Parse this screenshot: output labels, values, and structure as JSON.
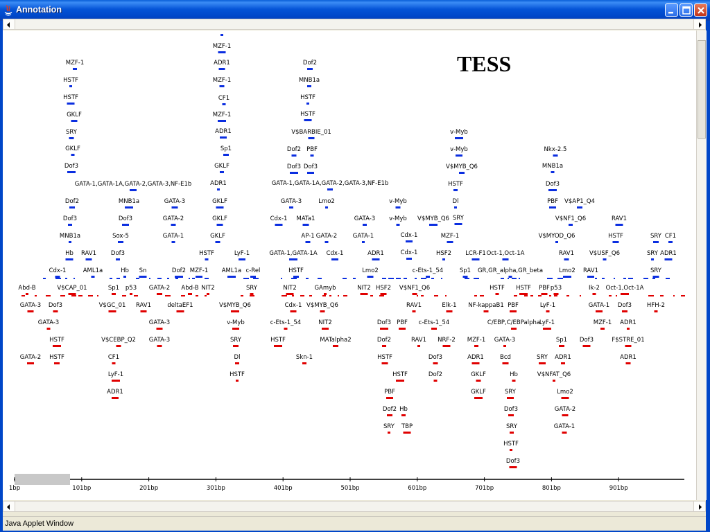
{
  "window": {
    "title": "Annotation",
    "status_text": "Java Applet Window",
    "heading": "TESS"
  },
  "colors": {
    "forward_strand": "#0b2ee0",
    "reverse_strand": "#e00000",
    "axis": "#000000"
  },
  "icons": [
    "java-icon",
    "minimize-icon",
    "maximize-icon",
    "close-icon",
    "scroll-left-icon",
    "scroll-right-icon"
  ],
  "axis": {
    "ticks": [
      "1bp",
      "101bp",
      "201bp",
      "301bp",
      "401bp",
      "501bp",
      "601bp",
      "701bp",
      "801bp",
      "901bp"
    ]
  },
  "annotations": {
    "forward": [
      "ADR1",
      "MZF-1",
      "ADR1",
      "MZF-1",
      "CF1",
      "MZF-1",
      "ADR1",
      "Sp1",
      "GKLF",
      "ADR1",
      "GKLF",
      "GKLF",
      "GKLF",
      "HSTF",
      "AML1a",
      "LyF-1",
      "c-Rel",
      "MZF-1",
      "HSTF",
      "HSTF",
      "GKLF",
      "SRY",
      "GKLF",
      "Dof3",
      "GATA-1,GATA-1A,GATA-2,GATA-3,NF-E1b",
      "Dof2",
      "Dof3",
      "MNB1a",
      "Hb",
      "RAV1",
      "Cdx-1",
      "AML1a",
      "MNB1a",
      "Dof3",
      "Sox-5",
      "Dof3",
      "Hb",
      "Sn",
      "GATA-3",
      "GATA-2",
      "GATA-1",
      "Dof2",
      "MZF-1",
      "Dof2",
      "MNB1a",
      "HSTF",
      "HSTF",
      "V$BARBIE_01",
      "Dof2",
      "PBF",
      "Dof3",
      "Dof3",
      "GATA-1,GATA-1A,GATA-2,GATA-3,NF-E1b",
      "GATA-3",
      "Lmo2",
      "Cdx-1",
      "MATa1",
      "AP-1",
      "GATA-2",
      "GATA-1,GATA-1A",
      "Cdx-1",
      "HSTF",
      "GATA-3",
      "GATA-1",
      "ADR1",
      "Lmo2",
      "v-Myb",
      "v-Myb",
      "V$MYB_Q6",
      "Cdx-1",
      "Cdx-1",
      "c-Ets-1_54",
      "HSF2",
      "LCR-F1",
      "Oct-1,Oct-1A",
      "Sp1",
      "GR,GR_alpha,GR_beta",
      "v-Myb",
      "v-Myb",
      "V$MYB_Q6",
      "HSTF",
      "Dl",
      "SRY",
      "MZF-1",
      "Nkx-2.5",
      "MNB1a",
      "Dof3",
      "PBF",
      "V$AP1_Q4",
      "V$NF1_Q6",
      "V$MYOD_Q6",
      "RAV1",
      "HSTF",
      "RAV1",
      "V$USF_Q6",
      "Lmo2",
      "RAV1",
      "SRY",
      "CF1",
      "SRY",
      "ADR1",
      "SRY"
    ],
    "reverse": [
      "Abd-B",
      "V$CAP_01",
      "GATA-3",
      "Dof3",
      "GATA-3",
      "HSTF",
      "GATA-2",
      "HSTF",
      "Sp1",
      "p53",
      "V$GC_01",
      "RAV1",
      "V$CEBP_Q2",
      "CF1",
      "LyF-1",
      "ADR1",
      "GATA-2",
      "Abd-B",
      "NIT2",
      "deltaEF1",
      "GATA-3",
      "GATA-3",
      "SRY",
      "V$MYB_Q6",
      "v-Myb",
      "SRY",
      "Dl",
      "HSTF",
      "NIT2",
      "Cdx-1",
      "V$MYB_Q6",
      "c-Ets-1_54",
      "HSTF",
      "NIT2",
      "MATalpha2",
      "Skn-1",
      "GAmyb",
      "NIT2",
      "HSF2",
      "V$NF1_Q6",
      "RAV1",
      "Dof3",
      "PBF",
      "c-Ets-1_54",
      "Dof2",
      "RAV1",
      "NRF-2",
      "HSTF",
      "Dof3",
      "Dof2",
      "HSTF",
      "PBF",
      "Dof2",
      "Hb",
      "SRY",
      "TBP",
      "Elk-1",
      "NF-kappaB1",
      "HSTF",
      "HSTF",
      "PBF",
      "C/EBP,C/EBPalpha",
      "MZF-1",
      "GATA-3",
      "ADR1",
      "Bcd",
      "GKLF",
      "Hb",
      "GKLF",
      "SRY",
      "Dof3",
      "SRY",
      "HSTF",
      "Dof3",
      "PBF",
      "p53",
      "LyF-1",
      "LyF-1",
      "SRY",
      "Sp1",
      "ADR1",
      "V$NFAT_Q6",
      "Lmo2",
      "GATA-2",
      "GATA-1",
      "Ik-2",
      "Oct-1,Oct-1A",
      "GATA-1",
      "Dof3",
      "MZF-1",
      "ADR1",
      "Dof3",
      "F$STRE_01",
      "ADR1",
      "HFH-2"
    ]
  }
}
